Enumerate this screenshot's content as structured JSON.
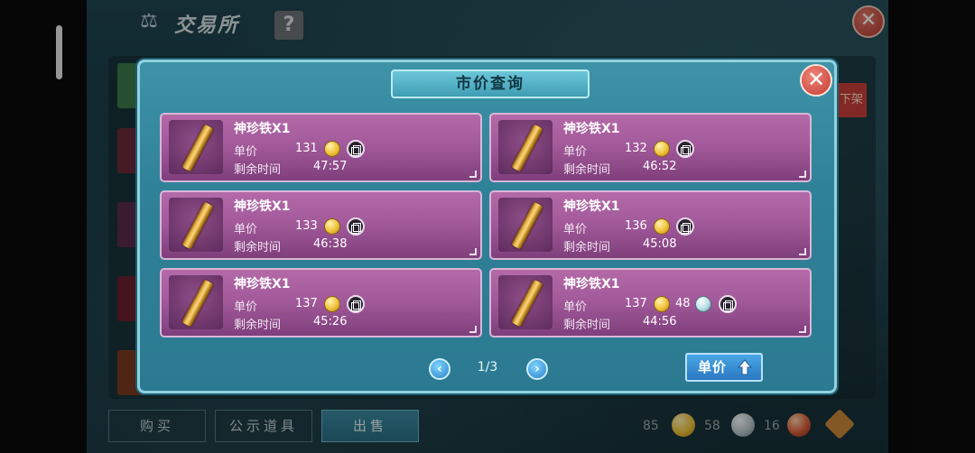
{
  "background": {
    "title": "交易所",
    "help_label": "?",
    "unlist_label": "下架",
    "tabs": [
      {
        "label": "购买",
        "active": false
      },
      {
        "label": "公示道具",
        "active": false
      },
      {
        "label": "出售",
        "active": true
      }
    ],
    "currencies": [
      {
        "amount": "85",
        "type": "gold-coin"
      },
      {
        "amount": "58",
        "type": "silver-coin"
      },
      {
        "amount": "16",
        "type": "red-coin"
      }
    ]
  },
  "modal": {
    "title": "市价查询",
    "price_label": "单价",
    "time_label": "剩余时间",
    "listings": [
      {
        "name": "神珍铁X1",
        "price": "131",
        "time": "47:57"
      },
      {
        "name": "神珍铁X1",
        "price": "132",
        "time": "46:52"
      },
      {
        "name": "神珍铁X1",
        "price": "133",
        "time": "46:38"
      },
      {
        "name": "神珍铁X1",
        "price": "136",
        "time": "45:08"
      },
      {
        "name": "神珍铁X1",
        "price": "137",
        "time": "45:26"
      },
      {
        "name": "神珍铁X1",
        "price": "137",
        "price_extra": "48",
        "time": "44:56"
      }
    ],
    "pager": {
      "text": "1/3"
    },
    "sort_button": {
      "label": "单价"
    }
  },
  "colors": {
    "modal_bg": "#2f8198",
    "card_bg": "#a35a9b",
    "close_red": "#c23c32",
    "accent_blue": "#2a78c2"
  }
}
